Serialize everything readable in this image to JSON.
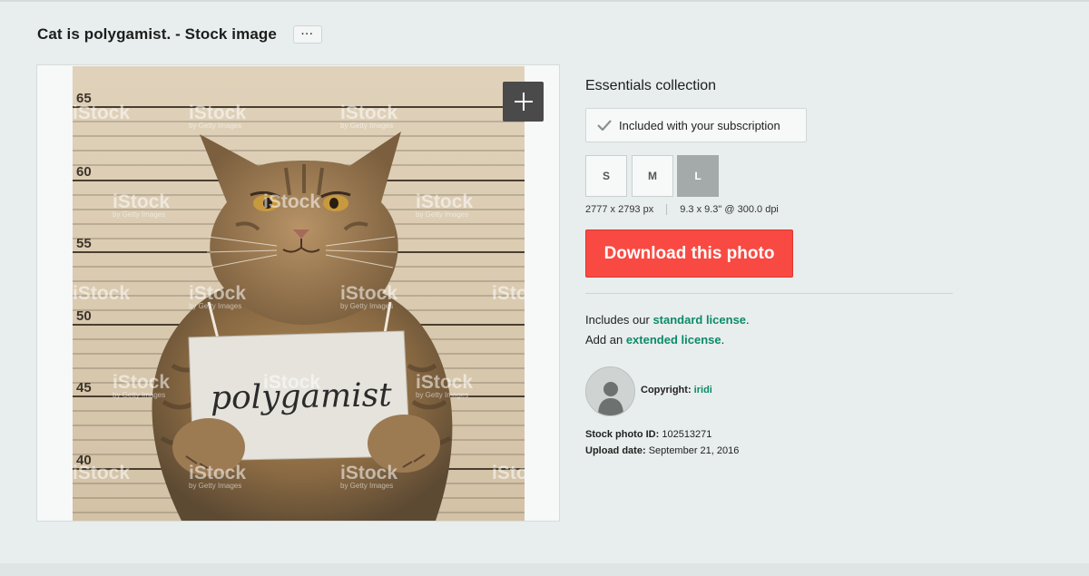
{
  "page": {
    "title": "Cat is polygamist. - Stock image",
    "more_label": "···"
  },
  "photo": {
    "sign_text": "polygamist",
    "watermark": "iStock",
    "watermark_sub": "by Getty Images",
    "height_marks": [
      "65",
      "60",
      "55",
      "50",
      "45",
      "40"
    ]
  },
  "icons": {
    "zoom": "plus-icon",
    "included": "check-icon",
    "avatar": "user-silhouette-icon",
    "more": "ellipsis-icon"
  },
  "details": {
    "collection": "Essentials collection",
    "included_text": "Included with your subscription",
    "sizes": [
      {
        "label": "S",
        "selected": false
      },
      {
        "label": "M",
        "selected": false
      },
      {
        "label": "L",
        "selected": true
      }
    ],
    "pixel_dims": "2777 x 2793 px",
    "print_dims": "9.3 x 9.3\" @ 300.0 dpi",
    "download_label": "Download this photo",
    "license_prefix": "Includes our ",
    "license_link": "standard license",
    "license_suffix": ".",
    "ext_prefix": "Add an ",
    "ext_link": "extended license",
    "ext_suffix": ".",
    "copyright_label": "Copyright:",
    "copyright_name": "iridi",
    "stock_id_label": "Stock photo ID:",
    "stock_id": "102513271",
    "upload_label": "Upload date:",
    "upload_date": "September 21, 2016"
  },
  "colors": {
    "download": "#f84a42",
    "link": "#0c8a6a",
    "size_selected": "#a3aaa9",
    "background": "#e8eeed"
  }
}
